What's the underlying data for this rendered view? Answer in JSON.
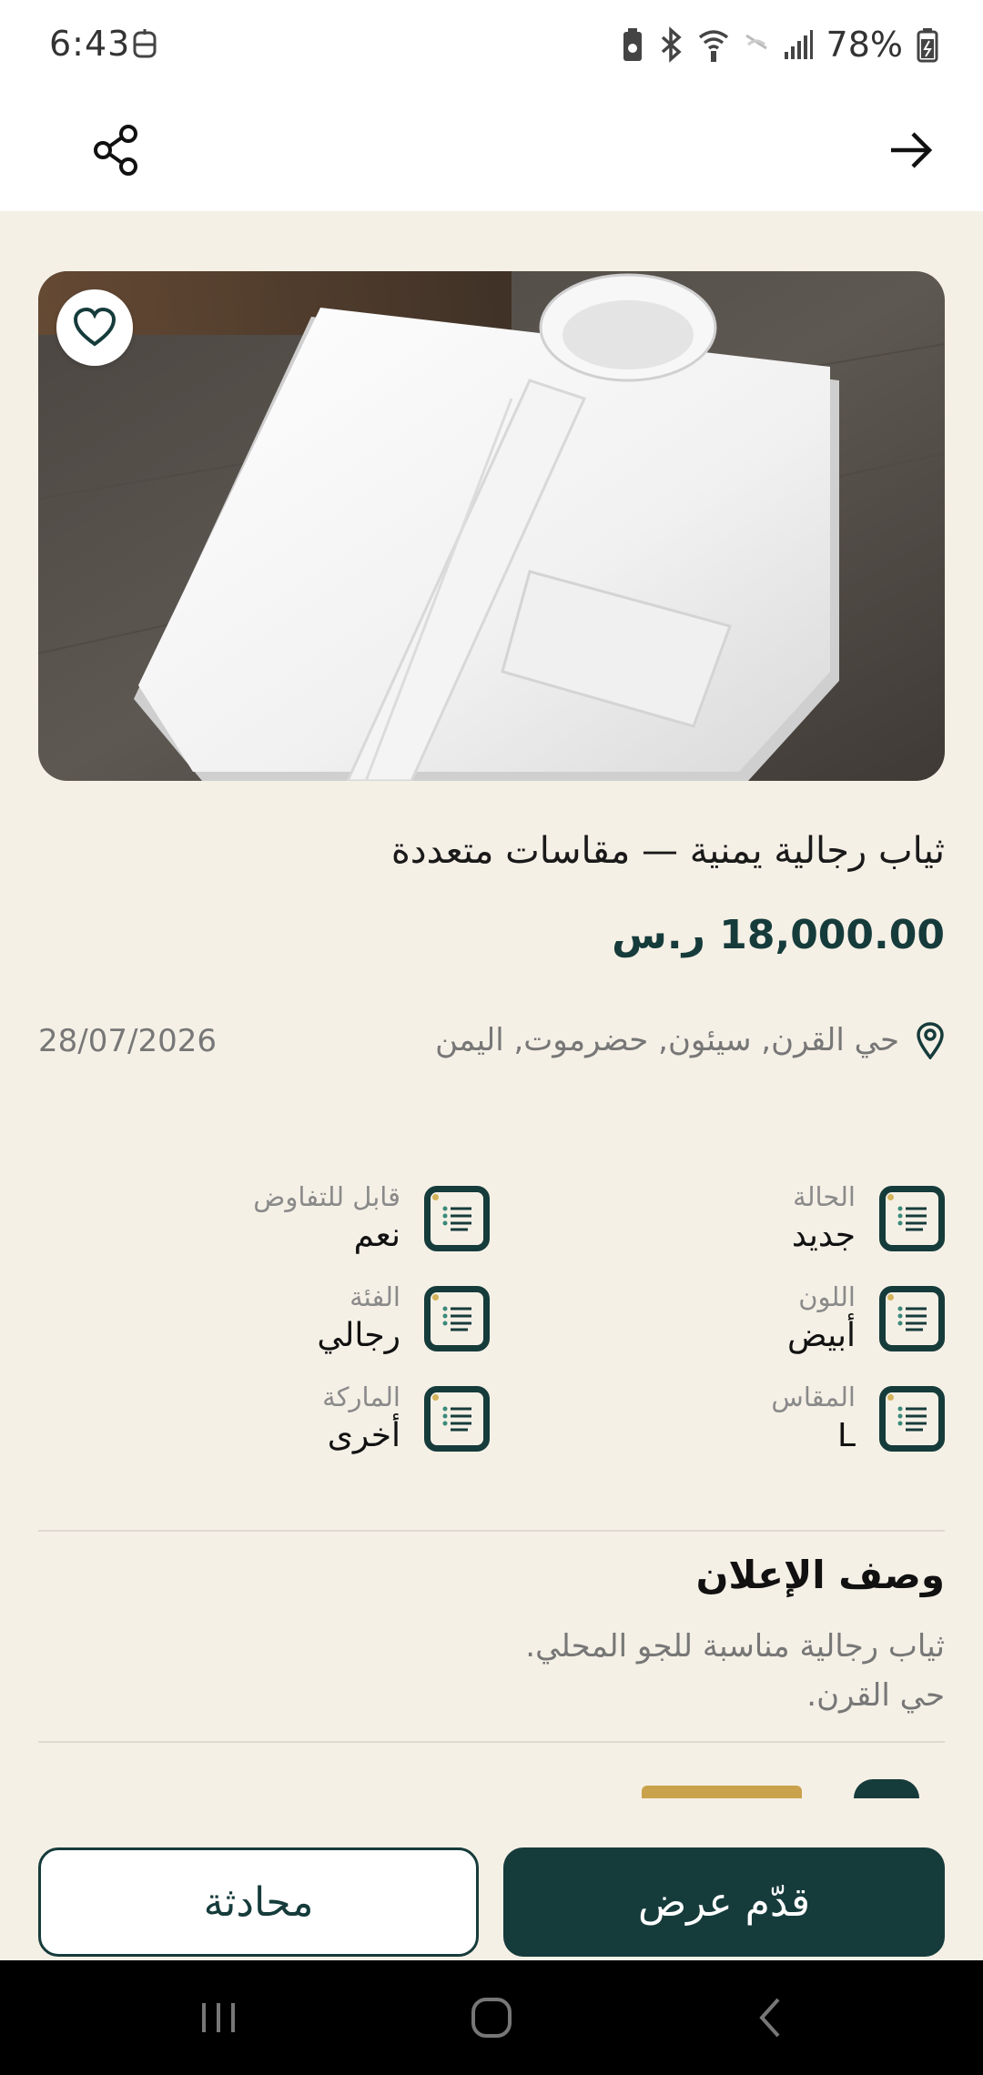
{
  "status_bar": {
    "time": "6:43",
    "battery": "78%"
  },
  "app_bar": {
    "share_icon": "share-icon",
    "back_icon": "arrow-right-icon"
  },
  "listing": {
    "image_alt": "white folded thobe on wooden table",
    "favorite_icon": "heart-outline-icon",
    "title": "ثياب رجالية يمنية — مقاسات متعددة",
    "price": "18,000.00 ر.س",
    "location": "حي القرن, سيئون, حضرموت, اليمن",
    "date": "28/07/2026"
  },
  "specs": [
    {
      "label": "الحالة",
      "value": "جديد"
    },
    {
      "label": "قابل للتفاوض",
      "value": "نعم"
    },
    {
      "label": "اللون",
      "value": "أبيض"
    },
    {
      "label": "الفئة",
      "value": "رجالي"
    },
    {
      "label": "المقاس",
      "value": "L"
    },
    {
      "label": "الماركة",
      "value": "أخرى"
    }
  ],
  "description": {
    "title": "وصف الإعلان",
    "line1": "ثياب رجالية مناسبة للجو المحلي.",
    "line2": "حي القرن."
  },
  "actions": {
    "chat": "محادثة",
    "offer": "قدّم عرض"
  },
  "colors": {
    "primary": "#163b3b",
    "background": "#f5f0e6",
    "accent": "#c9a24b"
  }
}
